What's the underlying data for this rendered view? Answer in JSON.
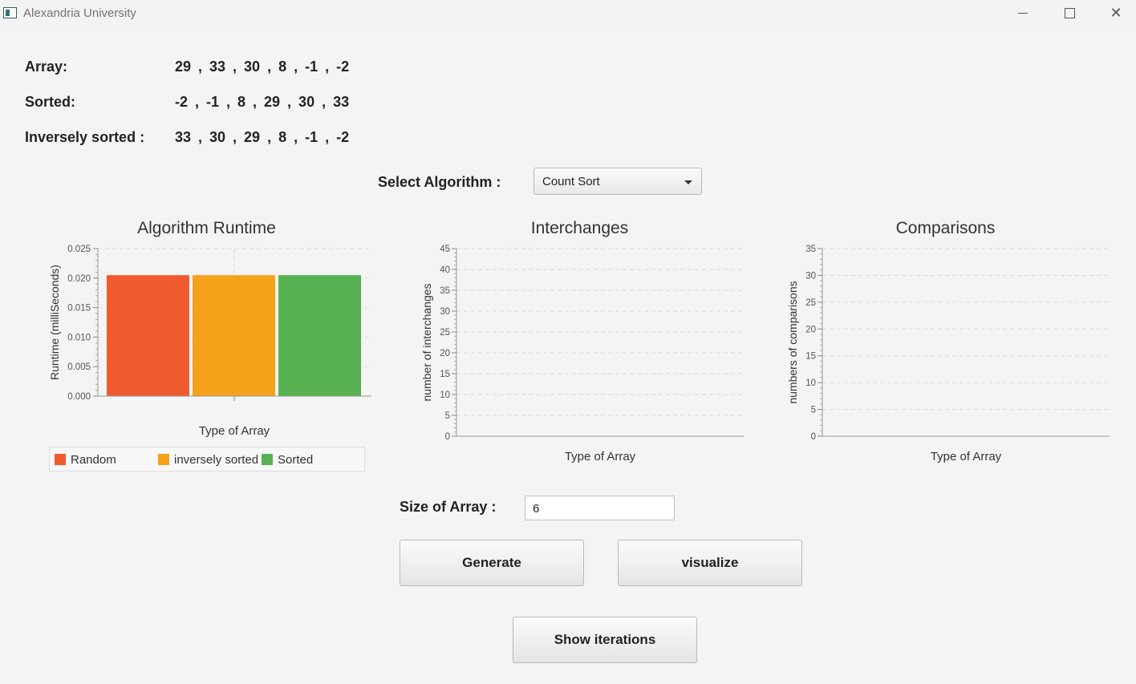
{
  "window": {
    "title": "Alexandria University",
    "min_icon": "minimize-icon",
    "max_icon": "maximize-icon",
    "close_icon": "close-icon"
  },
  "arrays": [
    {
      "label": "Array:",
      "values": "29 , 33 , 30 , 8 , -1 , -2"
    },
    {
      "label": "Sorted:",
      "values": "-2 , -1 , 8 , 29 , 30 , 33"
    },
    {
      "label": "Inversely sorted :",
      "values": "33 , 30 , 29 , 8 , -1 , -2"
    }
  ],
  "algorithm": {
    "label": "Select Algorithm :",
    "selected": "Count Sort"
  },
  "colors": {
    "random": "#ef5a2f",
    "inversely_sorted": "#f6a11a",
    "sorted": "#58b153"
  },
  "chart_data": [
    {
      "type": "bar",
      "title": "Algorithm Runtime",
      "xlabel": "Type of Array",
      "ylabel": "Runtime (milliSeconds)",
      "ylim": [
        0,
        0.025
      ],
      "yticks": [
        "0.000",
        "0.005",
        "0.010",
        "0.015",
        "0.020",
        "0.025"
      ],
      "grid": true,
      "series": [
        {
          "name": "Random",
          "values": [
            0.0205
          ]
        },
        {
          "name": "inversely sorted",
          "values": [
            0.0205
          ]
        },
        {
          "name": "Sorted",
          "values": [
            0.0205
          ]
        }
      ],
      "legend": [
        "Random",
        "inversely sorted",
        "Sorted"
      ],
      "legend_position": "bottom"
    },
    {
      "type": "bar",
      "title": "Interchanges",
      "xlabel": "Type of Array",
      "ylabel": "number of interchanges",
      "ylim": [
        0,
        45
      ],
      "yticks": [
        "0",
        "5",
        "10",
        "15",
        "20",
        "25",
        "30",
        "35",
        "40",
        "45"
      ],
      "grid": true,
      "series": []
    },
    {
      "type": "bar",
      "title": "Comparisons",
      "xlabel": "Type of Array",
      "ylabel": "numbers of comparisons",
      "ylim": [
        0,
        35
      ],
      "yticks": [
        "0",
        "5",
        "10",
        "15",
        "20",
        "25",
        "30",
        "35"
      ],
      "grid": true,
      "series": []
    }
  ],
  "size": {
    "label": "Size of Array :",
    "value": "6"
  },
  "buttons": {
    "generate": "Generate",
    "visualize": "visualize",
    "show_iterations": "Show iterations"
  }
}
